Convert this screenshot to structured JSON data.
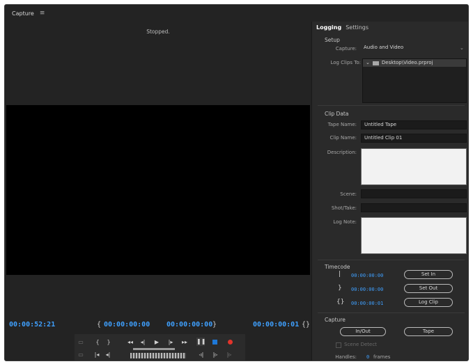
{
  "window": {
    "title": "Capture",
    "menu_icon": "hamburger-icon"
  },
  "monitor": {
    "status": "Stopped.",
    "current_timecode": "00:00:52:21",
    "in_point": "00:00:00:00",
    "out_point": "00:00:00:00",
    "duration": "00:00:00:01"
  },
  "transport": {
    "row1": [
      "{",
      "}",
      "◂◂",
      "◂|",
      "▶",
      "|▸",
      "▸▸"
    ],
    "row2": [
      "|◂",
      "◂|",
      "◃|",
      "|▹",
      "|▹"
    ]
  },
  "tabs": {
    "logging": "Logging",
    "settings": "Settings"
  },
  "setup": {
    "heading": "Setup",
    "capture_label": "Capture:",
    "capture_value": "Audio and Video",
    "log_clips_label": "Log Clips To:",
    "log_clips_value": "Desktop\\Video.prproj"
  },
  "clip_data": {
    "heading": "Clip Data",
    "tape_name_label": "Tape Name:",
    "tape_name_value": "Untitled Tape",
    "clip_name_label": "Clip Name:",
    "clip_name_value": "Untitled Clip 01",
    "description_label": "Description:",
    "scene_label": "Scene:",
    "shot_take_label": "Shot/Take:",
    "log_note_label": "Log Note:"
  },
  "timecode": {
    "heading": "Timecode",
    "in_value": "00:00:00:00",
    "out_value": "00:00:00:00",
    "duration_value": "00:00:00:01",
    "set_in_label": "Set In",
    "set_out_label": "Set Out",
    "log_clip_label": "Log Clip"
  },
  "capture_section": {
    "heading": "Capture",
    "in_out_label": "In/Out",
    "tape_label": "Tape",
    "scene_detect_label": "Scene Detect",
    "handles_label": "Handles:",
    "handles_value": "0",
    "handles_unit": "frames"
  },
  "colors": {
    "timecode": "#3fa0ff",
    "record": "#e2342b",
    "stop": "#1e78d7",
    "panel": "#2a2a2a",
    "background": "#232323"
  }
}
